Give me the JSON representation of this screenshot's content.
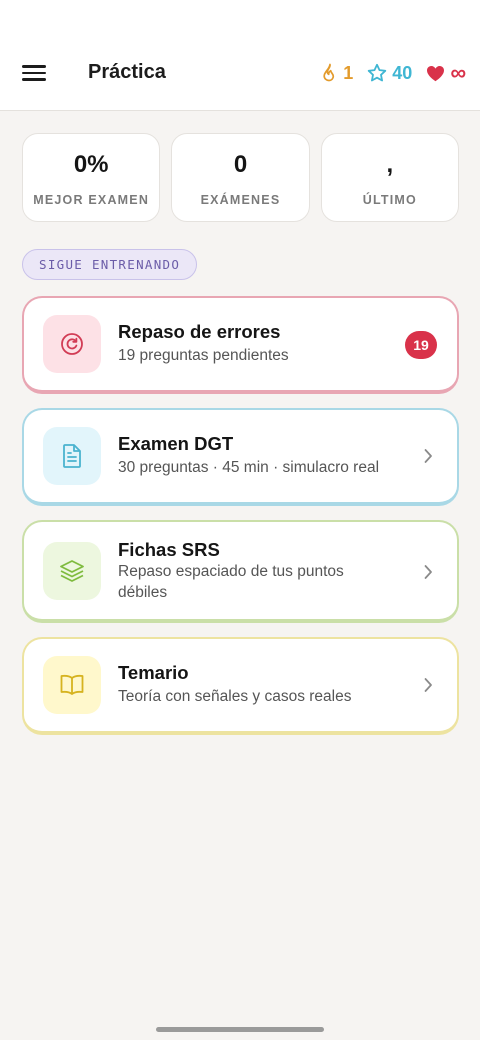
{
  "header": {
    "title": "Práctica",
    "streak": "1",
    "xp": "40",
    "lives": "∞"
  },
  "kpis": [
    {
      "value": "0%",
      "label": "MEJOR EXAMEN"
    },
    {
      "value": "0",
      "label": "EXÁMENES"
    },
    {
      "value": ",",
      "label": "ÚLTIMO"
    }
  ],
  "section_label": "SIGUE ENTRENANDO",
  "cards": [
    {
      "title": "Repaso de errores",
      "subtitle": "19 preguntas pendientes",
      "badge": "19",
      "icon": "refresh-icon",
      "accent": "#e8a6b3",
      "icon_bg": "#fde1e6",
      "icon_color": "#d23c55"
    },
    {
      "title": "Examen DGT",
      "subtitle": "30 preguntas · 45 min · simulacro real",
      "icon": "document-icon",
      "accent": "#a9d8e6",
      "icon_bg": "#e2f5fb",
      "icon_color": "#4ab3cf"
    },
    {
      "title": "Fichas SRS",
      "subtitle": "Repaso espaciado de tus puntos débiles",
      "icon": "layers-icon",
      "accent": "#cadfa8",
      "icon_bg": "#edf7df",
      "icon_color": "#7fbb3f"
    },
    {
      "title": "Temario",
      "subtitle": "Teoría con señales y casos reales",
      "icon": "book-icon",
      "accent": "#ede3a0",
      "icon_bg": "#fff8cc",
      "icon_color": "#d6b31f"
    }
  ],
  "colors": {
    "streak": "#e39b2c",
    "xp": "#3fb6d3",
    "lives": "#d9324a"
  }
}
